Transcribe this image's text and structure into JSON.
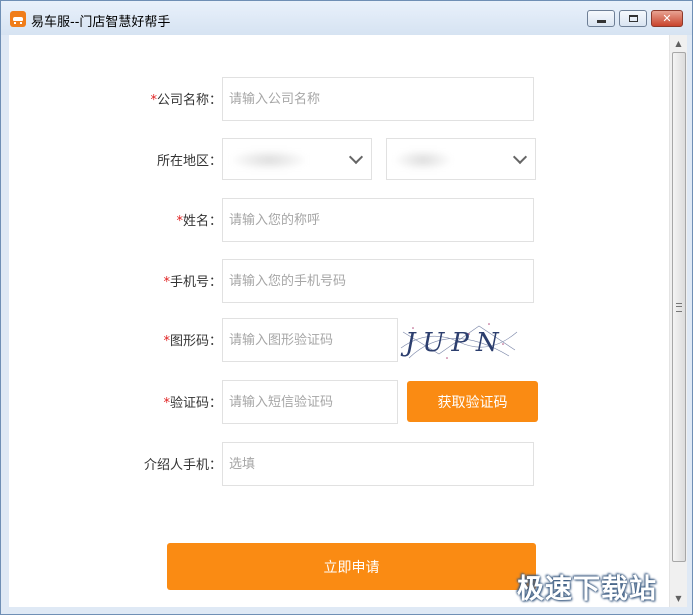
{
  "window": {
    "title": "易车服--门店智慧好帮手",
    "minimize_label": "",
    "maximize_label": "",
    "close_label": "✕"
  },
  "form": {
    "company": {
      "required": "*",
      "label": "公司名称：",
      "placeholder": "请输入公司名称"
    },
    "region": {
      "label": "所在地区："
    },
    "name": {
      "required": "*",
      "label": "姓名：",
      "placeholder": "请输入您的称呼"
    },
    "phone": {
      "required": "*",
      "label": "手机号：",
      "placeholder": "请输入您的手机号码"
    },
    "captcha": {
      "required": "*",
      "label": "图形码：",
      "placeholder": "请输入图形验证码",
      "image_text": "JUPN"
    },
    "sms": {
      "required": "*",
      "label": "验证码：",
      "placeholder": "请输入短信验证码",
      "button": "获取验证码"
    },
    "referrer": {
      "label": "介绍人手机：",
      "placeholder": "选填"
    },
    "submit": "立即申请"
  },
  "watermark": "极速下载站",
  "colors": {
    "accent": "#fa8b13",
    "required": "#e02020"
  }
}
